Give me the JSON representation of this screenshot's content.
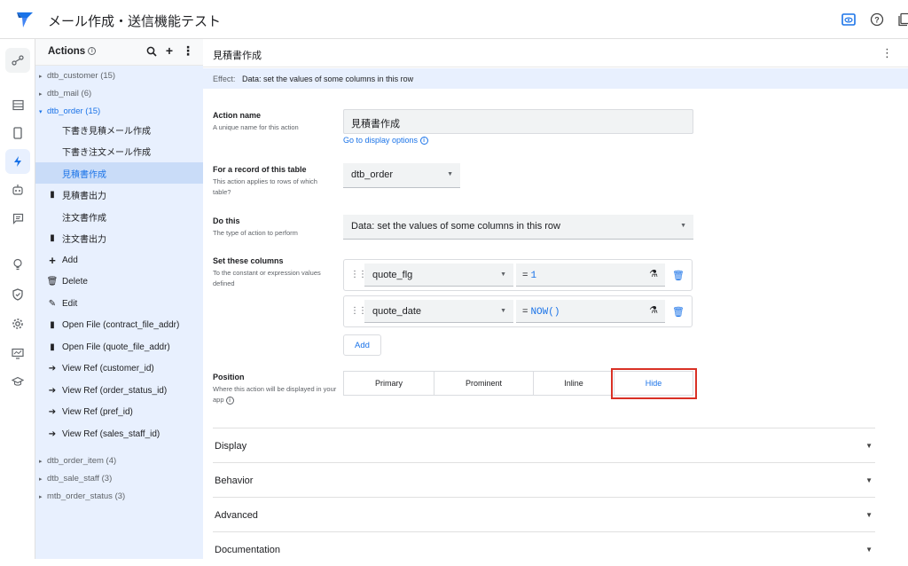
{
  "app": {
    "title": "メール作成・送信機能テスト",
    "brand_color": "#1a73e8"
  },
  "topbar_icons": [
    "preview-icon",
    "help-icon",
    "copy-icon"
  ],
  "rail_icons": [
    "network-icon",
    "table-icon",
    "phone-icon",
    "bolt-icon",
    "robot-icon",
    "chat-icon",
    "bulb-icon",
    "shield-icon",
    "gear-icon",
    "monitor-icon",
    "graduation-icon"
  ],
  "sidebar": {
    "title": "Actions",
    "groups_top": [
      {
        "label": "dtb_customer (15)"
      },
      {
        "label": "dtb_mail (6)"
      },
      {
        "label": "dtb_order (15)"
      }
    ],
    "items": [
      {
        "label": "下書き見積メール作成",
        "icon": ""
      },
      {
        "label": "下書き注文メール作成",
        "icon": ""
      },
      {
        "label": "見積書作成",
        "icon": ""
      },
      {
        "label": "見積書出力",
        "icon": "file-icon"
      },
      {
        "label": "注文書作成",
        "icon": ""
      },
      {
        "label": "注文書出力",
        "icon": "file-icon"
      },
      {
        "label": "Add",
        "icon": "plus-icon"
      },
      {
        "label": "Delete",
        "icon": "trash-icon"
      },
      {
        "label": "Edit",
        "icon": "edit-icon"
      },
      {
        "label": "Open File (contract_file_addr)",
        "icon": "file-icon"
      },
      {
        "label": "Open File (quote_file_addr)",
        "icon": "file-icon"
      },
      {
        "label": "View Ref (customer_id)",
        "icon": "arrow-circle-icon"
      },
      {
        "label": "View Ref (order_status_id)",
        "icon": "arrow-circle-icon"
      },
      {
        "label": "View Ref (pref_id)",
        "icon": "arrow-circle-icon"
      },
      {
        "label": "View Ref (sales_staff_id)",
        "icon": "arrow-circle-icon"
      }
    ],
    "groups_bottom": [
      {
        "label": "dtb_order_item (4)"
      },
      {
        "label": "dtb_sale_staff (3)"
      },
      {
        "label": "mtb_order_status (3)"
      }
    ]
  },
  "main": {
    "title": "見積書作成",
    "effect_label": "Effect:",
    "effect_value": "Data: set the values of some columns in this row",
    "action_name": {
      "label": "Action name",
      "desc": "A unique name for this action",
      "value": "見積書作成",
      "link": "Go to display options"
    },
    "record_table": {
      "label": "For a record of this table",
      "desc": "This action applies to rows of which table?",
      "value": "dtb_order"
    },
    "do_this": {
      "label": "Do this",
      "desc": "The type of action to perform",
      "value": "Data: set the values of some columns in this row"
    },
    "set_columns": {
      "label": "Set these columns",
      "desc": "To the constant or expression values defined",
      "rows": [
        {
          "column": "quote_flg",
          "eq": "=",
          "expr": "1"
        },
        {
          "column": "quote_date",
          "eq": "=",
          "expr": "NOW()"
        }
      ],
      "add_label": "Add"
    },
    "position": {
      "label": "Position",
      "desc": "Where this action will be displayed in your app",
      "options": [
        "Primary",
        "Prominent",
        "Inline",
        "Hide"
      ],
      "selected": "Hide"
    },
    "sections": [
      "Display",
      "Behavior",
      "Advanced",
      "Documentation"
    ]
  }
}
